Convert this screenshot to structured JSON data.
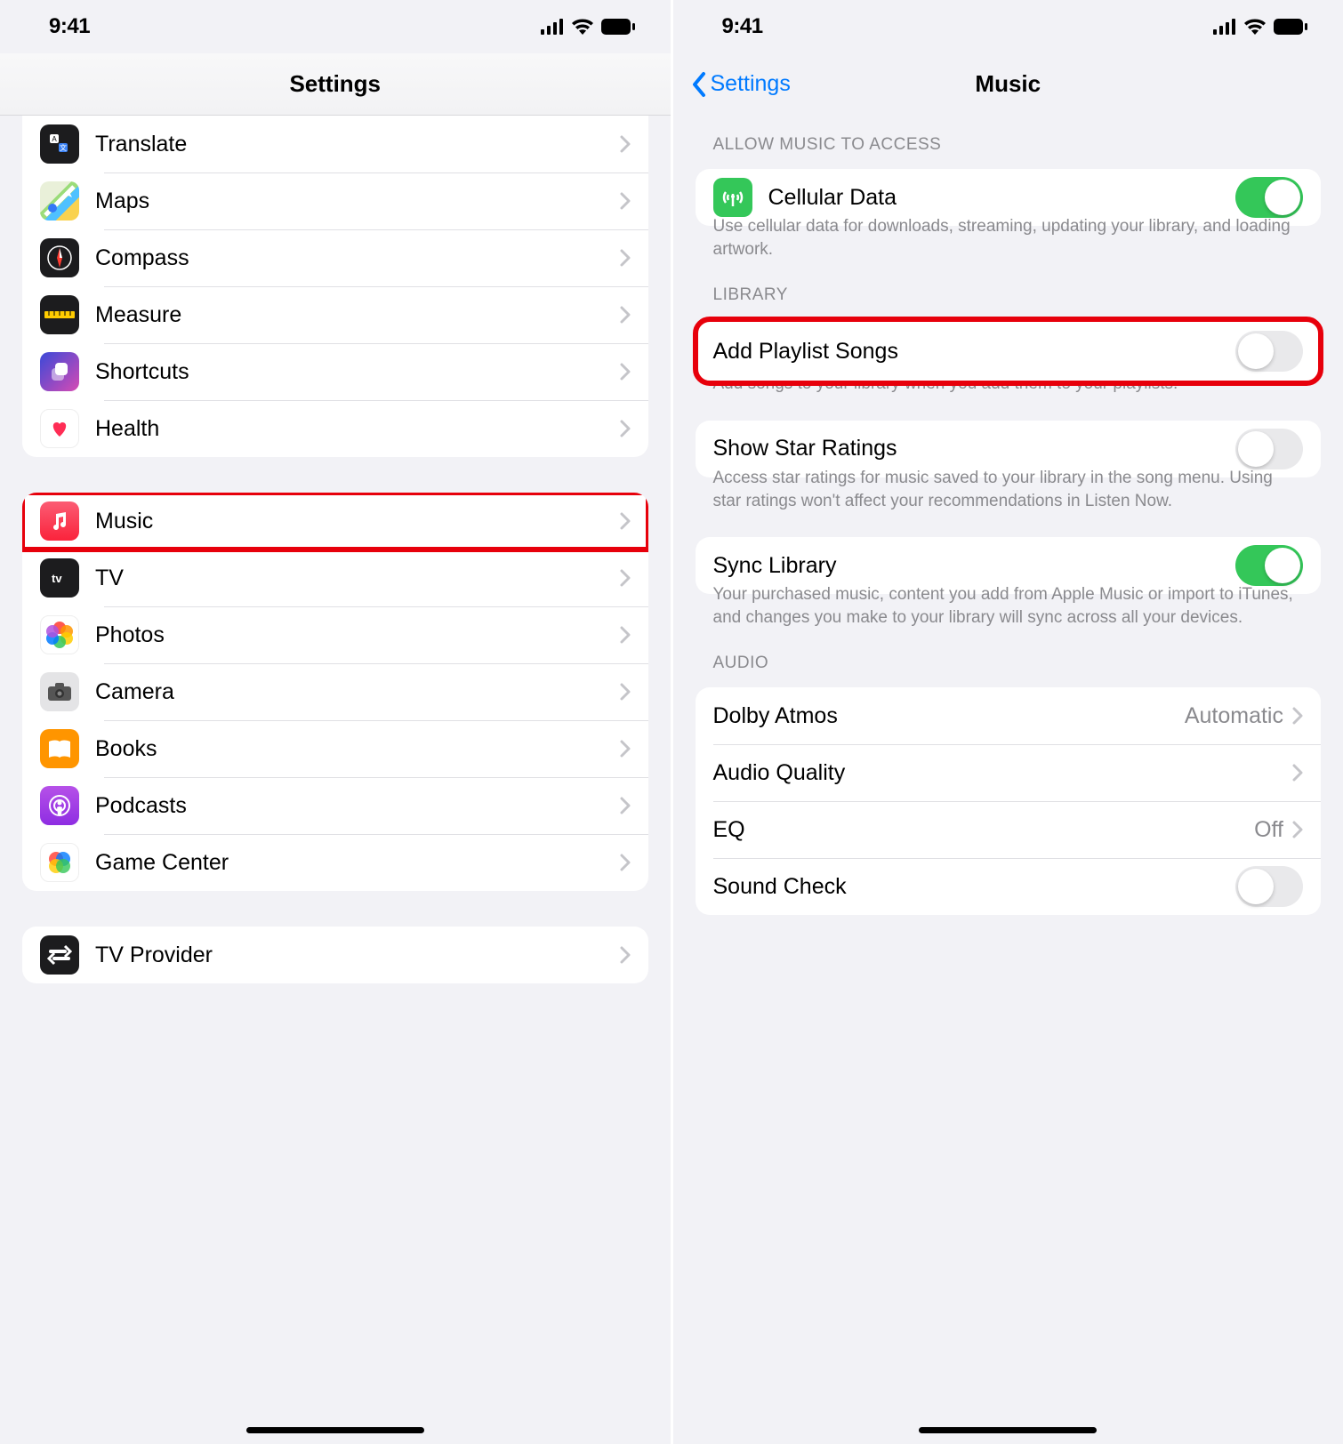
{
  "status_time": "9:41",
  "left": {
    "title": "Settings",
    "group1": [
      {
        "label": "Translate",
        "icon": "translate"
      },
      {
        "label": "Maps",
        "icon": "maps"
      },
      {
        "label": "Compass",
        "icon": "compass"
      },
      {
        "label": "Measure",
        "icon": "measure"
      },
      {
        "label": "Shortcuts",
        "icon": "shortcuts"
      },
      {
        "label": "Health",
        "icon": "health"
      }
    ],
    "group2": [
      {
        "label": "Music",
        "icon": "music",
        "highlight": true
      },
      {
        "label": "TV",
        "icon": "tv"
      },
      {
        "label": "Photos",
        "icon": "photos"
      },
      {
        "label": "Camera",
        "icon": "camera"
      },
      {
        "label": "Books",
        "icon": "books"
      },
      {
        "label": "Podcasts",
        "icon": "podcasts"
      },
      {
        "label": "Game Center",
        "icon": "gamecenter"
      }
    ],
    "group3": [
      {
        "label": "TV Provider",
        "icon": "tvprovider"
      }
    ]
  },
  "right": {
    "back": "Settings",
    "title": "Music",
    "section1_header": "Allow Music to Access",
    "cellular_label": "Cellular Data",
    "cellular_on": true,
    "cellular_footer": "Use cellular data for downloads, streaming, updating your library, and loading artwork.",
    "section2_header": "Library",
    "addplaylist_label": "Add Playlist Songs",
    "addplaylist_on": false,
    "addplaylist_footer": "Add songs to your library when you add them to your playlists.",
    "star_label": "Show Star Ratings",
    "star_on": false,
    "star_footer": "Access star ratings for music saved to your library in the song menu. Using star ratings won't affect your recommendations in Listen Now.",
    "sync_label": "Sync Library",
    "sync_on": true,
    "sync_footer": "Your purchased music, content you add from Apple Music or import to iTunes, and changes you make to your library will sync across all your devices.",
    "section3_header": "Audio",
    "dolby_label": "Dolby Atmos",
    "dolby_value": "Automatic",
    "audioq_label": "Audio Quality",
    "eq_label": "EQ",
    "eq_value": "Off",
    "soundcheck_label": "Sound Check",
    "soundcheck_on": false
  }
}
